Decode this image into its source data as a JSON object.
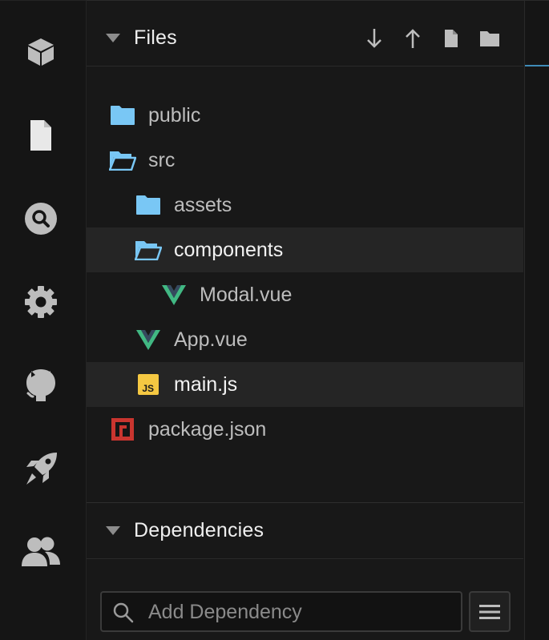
{
  "activity_bar": {
    "items": [
      {
        "icon": "cube-icon"
      },
      {
        "icon": "file-icon"
      },
      {
        "icon": "search-icon"
      },
      {
        "icon": "gear-icon"
      },
      {
        "icon": "github-icon"
      },
      {
        "icon": "rocket-icon"
      },
      {
        "icon": "users-icon"
      }
    ]
  },
  "files": {
    "title": "Files",
    "actions": [
      {
        "icon": "arrow-down-icon"
      },
      {
        "icon": "arrow-up-icon"
      },
      {
        "icon": "new-file-icon"
      },
      {
        "icon": "new-folder-icon"
      }
    ],
    "tree": [
      {
        "label": "public",
        "icon": "folder-icon",
        "depth": 0,
        "selected": false
      },
      {
        "label": "src",
        "icon": "folder-open-icon",
        "depth": 0,
        "selected": false
      },
      {
        "label": "assets",
        "icon": "folder-icon",
        "depth": 1,
        "selected": false
      },
      {
        "label": "components",
        "icon": "folder-open-icon",
        "depth": 1,
        "selected": true
      },
      {
        "label": "Modal.vue",
        "icon": "vue-icon",
        "depth": 2,
        "selected": false
      },
      {
        "label": "App.vue",
        "icon": "vue-icon",
        "depth": 1,
        "selected": false
      },
      {
        "label": "main.js",
        "icon": "js-icon",
        "depth": 1,
        "selected": true
      },
      {
        "label": "package.json",
        "icon": "npm-icon",
        "depth": 0,
        "selected": false
      }
    ]
  },
  "dependencies": {
    "title": "Dependencies",
    "search_placeholder": "Add Dependency"
  },
  "colors": {
    "folder": "#79c7f5",
    "vue_green": "#41b883",
    "vue_dark": "#35495e",
    "js_yellow": "#f5c842",
    "npm_red": "#c9352f",
    "accent": "#3f8bb8"
  }
}
